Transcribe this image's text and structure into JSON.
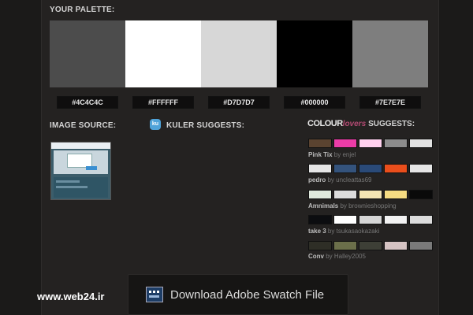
{
  "headings": {
    "palette": "YOUR PALETTE:",
    "image_source": "IMAGE SOURCE:",
    "kuler": "KULER SUGGESTS:",
    "kuler_icon_text": "ku",
    "colourlovers_a": "COLOUR",
    "colourlovers_b": "lovers",
    "colourlovers_suggests": "SUGGESTS:"
  },
  "palette": [
    {
      "hex": "#4C4C4C",
      "color": "#4c4c4c"
    },
    {
      "hex": "#FFFFFF",
      "color": "#ffffff"
    },
    {
      "hex": "#D7D7D7",
      "color": "#d7d7d7"
    },
    {
      "hex": "#000000",
      "color": "#000000"
    },
    {
      "hex": "#7E7E7E",
      "color": "#7e7e7e"
    }
  ],
  "suggestions": [
    {
      "name": "Pink Tix",
      "by": "by enjel",
      "colors": [
        "#5a4330",
        "#ec3ca8",
        "#ffd1ee",
        "#8c8c8c",
        "#e2e2e2"
      ]
    },
    {
      "name": "pedro",
      "by": "by uncleattas69",
      "colors": [
        "#e6e6e6",
        "#34537c",
        "#2a4a78",
        "#ea4e1c",
        "#e6e6e6"
      ]
    },
    {
      "name": "Amnimals",
      "by": "by brownieshopping",
      "colors": [
        "#dfe8dc",
        "#dcdcdc",
        "#f3e4b3",
        "#f6dc82",
        "#0a0a0a"
      ]
    },
    {
      "name": "take 3",
      "by": "by tsukasaokazaki",
      "colors": [
        "#0c0d10",
        "#ffffff",
        "#d6d6d6",
        "#f2f2f2",
        "#dcdcdc"
      ]
    },
    {
      "name": "Conv",
      "by": "by Halley2005",
      "colors": [
        "#2e2e26",
        "#6b6f4a",
        "#3d3f36",
        "#d5c3c3",
        "#7a7a7a"
      ]
    }
  ],
  "download_label": "Download Adobe Swatch File",
  "watermark": "www.web24.ir"
}
